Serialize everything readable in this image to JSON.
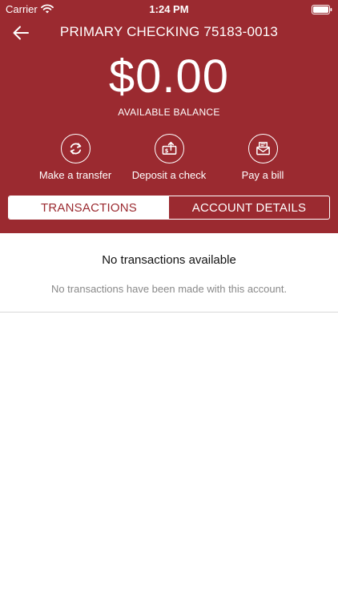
{
  "status_bar": {
    "carrier": "Carrier",
    "time": "1:24 PM"
  },
  "header": {
    "account_title": "PRIMARY CHECKING 75183-0013",
    "balance": "$0.00",
    "balance_label": "AVAILABLE BALANCE",
    "background_color": "#9b2a30"
  },
  "actions": [
    {
      "label": "Make a transfer",
      "icon": "transfer-icon"
    },
    {
      "label": "Deposit a check",
      "icon": "deposit-check-icon"
    },
    {
      "label": "Pay a bill",
      "icon": "pay-bill-icon"
    }
  ],
  "tabs": [
    {
      "label": "TRANSACTIONS",
      "active": true
    },
    {
      "label": "ACCOUNT DETAILS",
      "active": false
    }
  ],
  "empty_state": {
    "title": "No transactions available",
    "message": "No transactions have been made with this account."
  }
}
